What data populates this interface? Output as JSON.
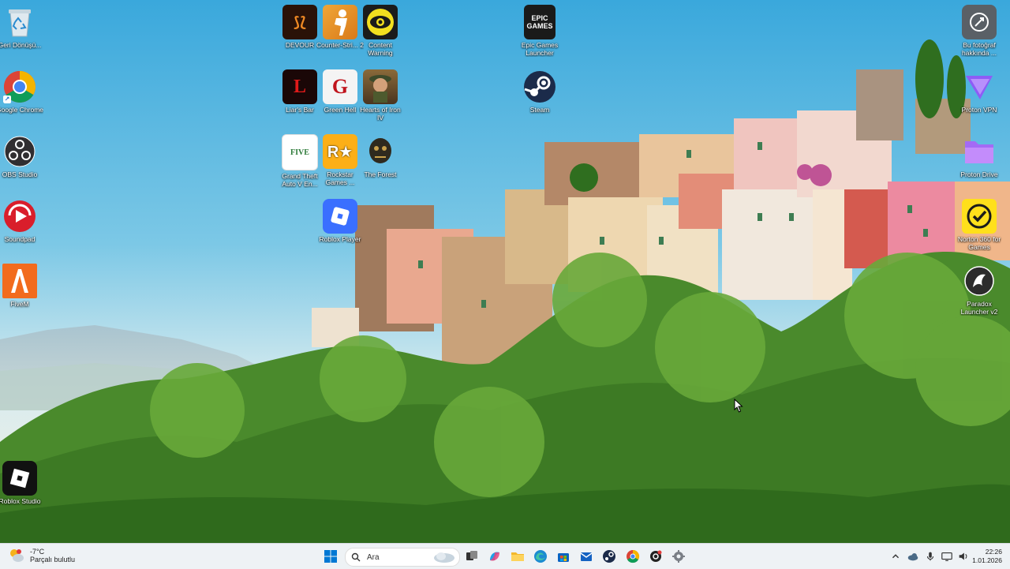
{
  "desktop": {
    "icons": [
      {
        "key": "recycle",
        "label": "Geri Dönüşü..."
      },
      {
        "key": "chrome",
        "label": "Google Chrome"
      },
      {
        "key": "obs",
        "label": "OBS Studio"
      },
      {
        "key": "soundpad",
        "label": "Soundpad"
      },
      {
        "key": "fivem",
        "label": "FiveM"
      },
      {
        "key": "roblox_studio",
        "label": "Roblox Studio"
      },
      {
        "key": "devour",
        "label": "DEVOUR"
      },
      {
        "key": "cs2",
        "label": "Counter-Stri... 2"
      },
      {
        "key": "content_warning",
        "label": "Content Warning"
      },
      {
        "key": "liars_bar",
        "label": "Liar's Bar"
      },
      {
        "key": "green_hell",
        "label": "Green Hell"
      },
      {
        "key": "hoi4",
        "label": "Hearts of Iron IV"
      },
      {
        "key": "gta5",
        "label": "Grand Theft Auto V En..."
      },
      {
        "key": "rockstar",
        "label": "Rockstar Games ..."
      },
      {
        "key": "the_forest",
        "label": "The Forest"
      },
      {
        "key": "roblox_player",
        "label": "Roblox Player"
      },
      {
        "key": "epic",
        "label": "Epic Games Launcher"
      },
      {
        "key": "steam",
        "label": "Steam"
      },
      {
        "key": "photo_info",
        "label": "Bu fotoğraf hakkında ..."
      },
      {
        "key": "proton_vpn",
        "label": "Proton VPN"
      },
      {
        "key": "proton_drive",
        "label": "Proton Drive"
      },
      {
        "key": "norton",
        "label": "Norton 360 for Games"
      },
      {
        "key": "paradox",
        "label": "Paradox Launcher v2"
      }
    ],
    "tiles": {
      "devour": "⟆⟅",
      "liars_bar": "L",
      "green_hell": "G",
      "gta5": "FIVE",
      "rockstar": "R★",
      "epic": "EPIC GAMES"
    }
  },
  "taskbar": {
    "weather": {
      "temp": "-7°C",
      "condition": "Parçalı bulutlu",
      "icon": "partly-cloudy-icon"
    },
    "search_placeholder": "Ara",
    "clock": {
      "time": "22:26",
      "date": "1.01.2026"
    },
    "pinned": [
      "start",
      "task-view",
      "copilot",
      "file-explorer",
      "edge",
      "store",
      "mail",
      "steam",
      "chrome",
      "gear-app",
      "settings"
    ]
  },
  "colors": {
    "taskbar_bg": "#eef2f5",
    "accent": "#0078d4"
  }
}
